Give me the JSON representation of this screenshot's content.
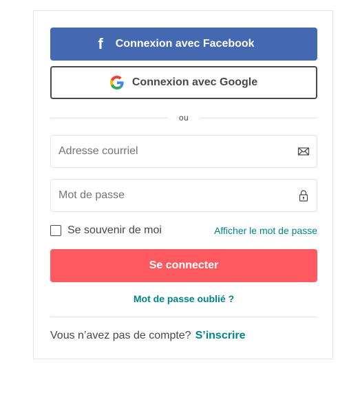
{
  "social": {
    "facebook_label": "Connexion avec Facebook",
    "facebook_icon_glyph": "f",
    "google_label": "Connexion avec Google"
  },
  "divider": {
    "text": "ou"
  },
  "form": {
    "email_placeholder": "Adresse courriel",
    "email_value": "",
    "password_placeholder": "Mot de passe",
    "password_value": "",
    "remember_label": "Se souvenir de moi",
    "remember_checked": false,
    "show_password_label": "Afficher le mot de passe",
    "submit_label": "Se connecter",
    "forgot_label": "Mot de passe oublié ?"
  },
  "signup": {
    "prompt": "Vous n’avez pas de compte?",
    "link_label": "S’inscrire"
  },
  "icons": {
    "facebook": "facebook-icon",
    "google": "google-icon",
    "email": "envelope-icon",
    "password": "lock-icon"
  },
  "colors": {
    "facebook": "#4568b2",
    "primary": "#ff5a5f",
    "link": "#008489",
    "text": "#484848",
    "border": "#e4e4e4"
  }
}
